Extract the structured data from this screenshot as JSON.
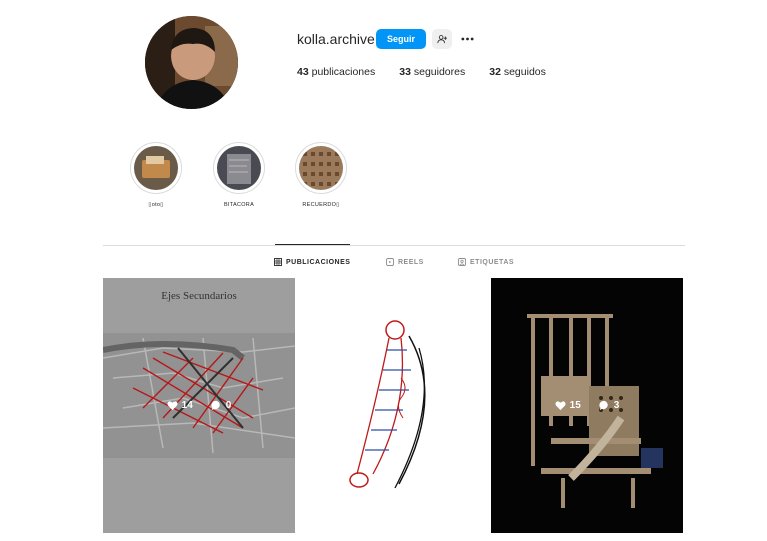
{
  "profile": {
    "username": "kolla.archive",
    "follow_label": "Seguir",
    "stats": [
      {
        "count": "43",
        "label": "publicaciones"
      },
      {
        "count": "33",
        "label": "seguidores"
      },
      {
        "count": "32",
        "label": "seguidos"
      }
    ]
  },
  "highlights": [
    {
      "label": "▯oto▯"
    },
    {
      "label": "BITACORA"
    },
    {
      "label": "RECUERDO▯"
    }
  ],
  "tabs": [
    {
      "label": "PUBLICACIONES",
      "icon": "grid-icon",
      "active": true
    },
    {
      "label": "REELS",
      "icon": "reels-icon",
      "active": false
    },
    {
      "label": "ETIQUETAS",
      "icon": "tagged-icon",
      "active": false
    }
  ],
  "posts": [
    {
      "title": "Ejes Secundarios",
      "likes": "14",
      "comments": "0"
    },
    {
      "likes": "",
      "comments": ""
    },
    {
      "likes": "15",
      "comments": "3"
    }
  ],
  "colors": {
    "accent": "#0095f6",
    "text": "#262626",
    "muted": "#8e8e8e",
    "border": "#dbdbdb"
  }
}
